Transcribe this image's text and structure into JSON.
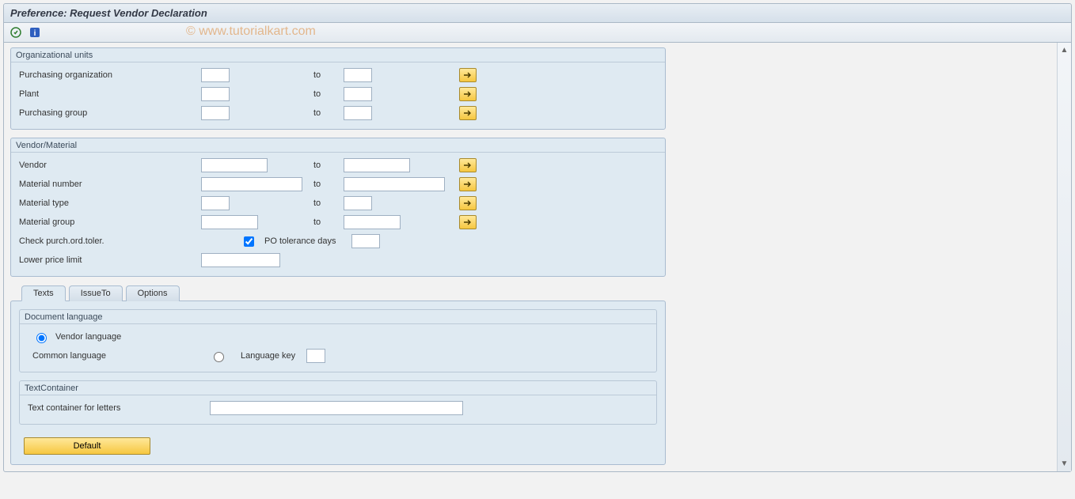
{
  "title": "Preference: Request Vendor Declaration",
  "watermark": "© www.tutorialkart.com",
  "groups": {
    "org": {
      "title": "Organizational units",
      "purch_org": "Purchasing organization",
      "plant": "Plant",
      "purch_group": "Purchasing group",
      "to": "to"
    },
    "vend": {
      "title": "Vendor/Material",
      "vendor": "Vendor",
      "material_no": "Material number",
      "material_type": "Material type",
      "material_group": "Material group",
      "check_po_toler": "Check purch.ord.toler.",
      "po_tol_days": "PO tolerance days",
      "lower_price": "Lower price limit",
      "to": "to"
    }
  },
  "tabs": {
    "texts": "Texts",
    "issueto": "IssueTo",
    "options": "Options"
  },
  "doc_lang": {
    "title": "Document language",
    "vendor_lang": "Vendor language",
    "common_lang": "Common language",
    "lang_key": "Language key"
  },
  "text_container": {
    "title": "TextContainer",
    "letters": "Text container for letters"
  },
  "default_btn": "Default",
  "po_check": true
}
